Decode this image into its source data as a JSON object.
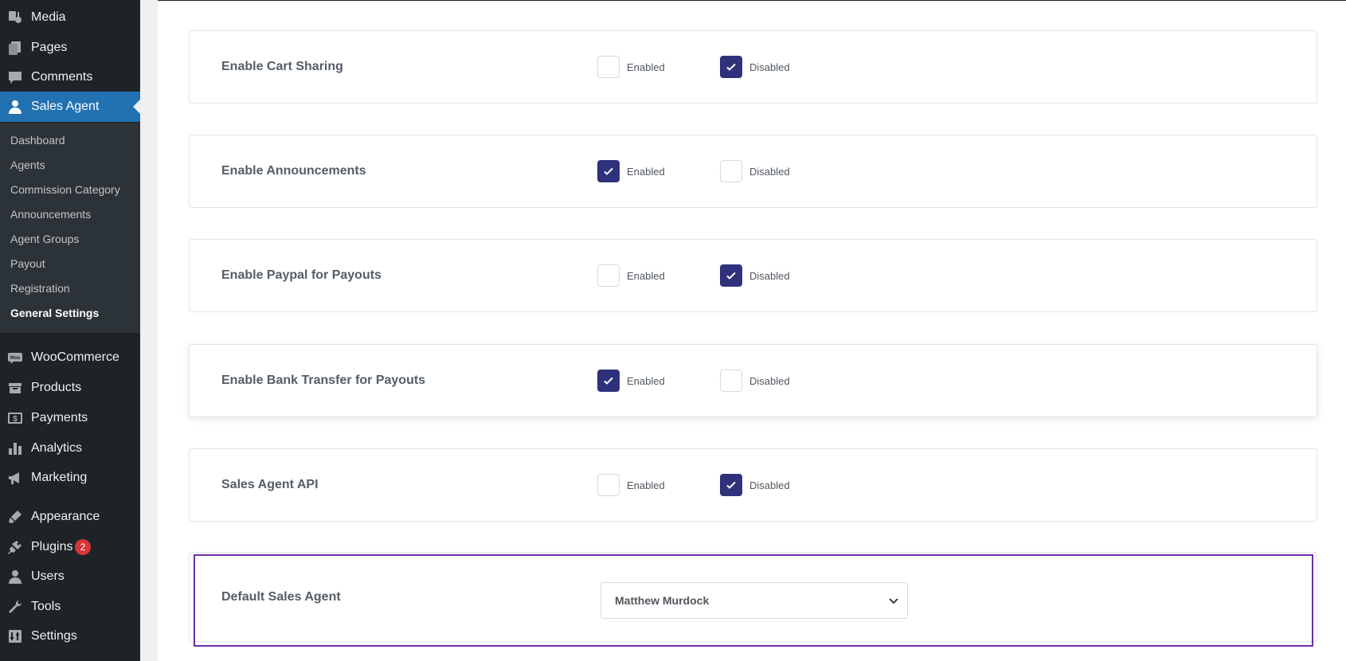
{
  "sidebar": {
    "menu_top": [
      {
        "label": "Media",
        "icon": "media-icon"
      },
      {
        "label": "Pages",
        "icon": "pages-icon"
      },
      {
        "label": "Comments",
        "icon": "comments-icon"
      },
      {
        "label": "Sales Agent",
        "icon": "user-icon"
      }
    ],
    "submenu": [
      {
        "label": "Dashboard"
      },
      {
        "label": "Agents"
      },
      {
        "label": "Commission Category"
      },
      {
        "label": "Announcements"
      },
      {
        "label": "Agent Groups"
      },
      {
        "label": "Payout"
      },
      {
        "label": "Registration"
      },
      {
        "label": "General Settings"
      }
    ],
    "menu_bottom": [
      {
        "label": "WooCommerce",
        "icon": "woocommerce-icon"
      },
      {
        "label": "Products",
        "icon": "products-icon"
      },
      {
        "label": "Payments",
        "icon": "payments-icon"
      },
      {
        "label": "Analytics",
        "icon": "analytics-icon"
      },
      {
        "label": "Marketing",
        "icon": "marketing-icon"
      },
      {
        "label": "Appearance",
        "icon": "appearance-icon"
      },
      {
        "label": "Plugins",
        "icon": "plugins-icon",
        "badge": "2"
      },
      {
        "label": "Users",
        "icon": "users-icon"
      },
      {
        "label": "Tools",
        "icon": "tools-icon"
      },
      {
        "label": "Settings",
        "icon": "settings-icon"
      }
    ]
  },
  "settings": [
    {
      "title": "Enable Cart Sharing",
      "enabled_label": "Enabled",
      "disabled_label": "Disabled",
      "value": "Disabled"
    },
    {
      "title": "Enable Announcements",
      "enabled_label": "Enabled",
      "disabled_label": "Disabled",
      "value": "Enabled"
    },
    {
      "title": "Enable Paypal for Payouts",
      "enabled_label": "Enabled",
      "disabled_label": "Disabled",
      "value": "Disabled"
    },
    {
      "title": "Enable Bank Transfer for Payouts",
      "enabled_label": "Enabled",
      "disabled_label": "Disabled",
      "value": "Enabled"
    },
    {
      "title": "Sales Agent API",
      "enabled_label": "Enabled",
      "disabled_label": "Disabled",
      "value": "Disabled"
    }
  ],
  "default_agent": {
    "title": "Default Sales Agent",
    "selected": "Matthew Murdock"
  },
  "colors": {
    "sidebar_bg": "#1d2327",
    "active_menu": "#2271b1",
    "checkbox_checked": "#2f327a",
    "highlight_border": "#6b2fa8",
    "badge": "#d63638"
  }
}
